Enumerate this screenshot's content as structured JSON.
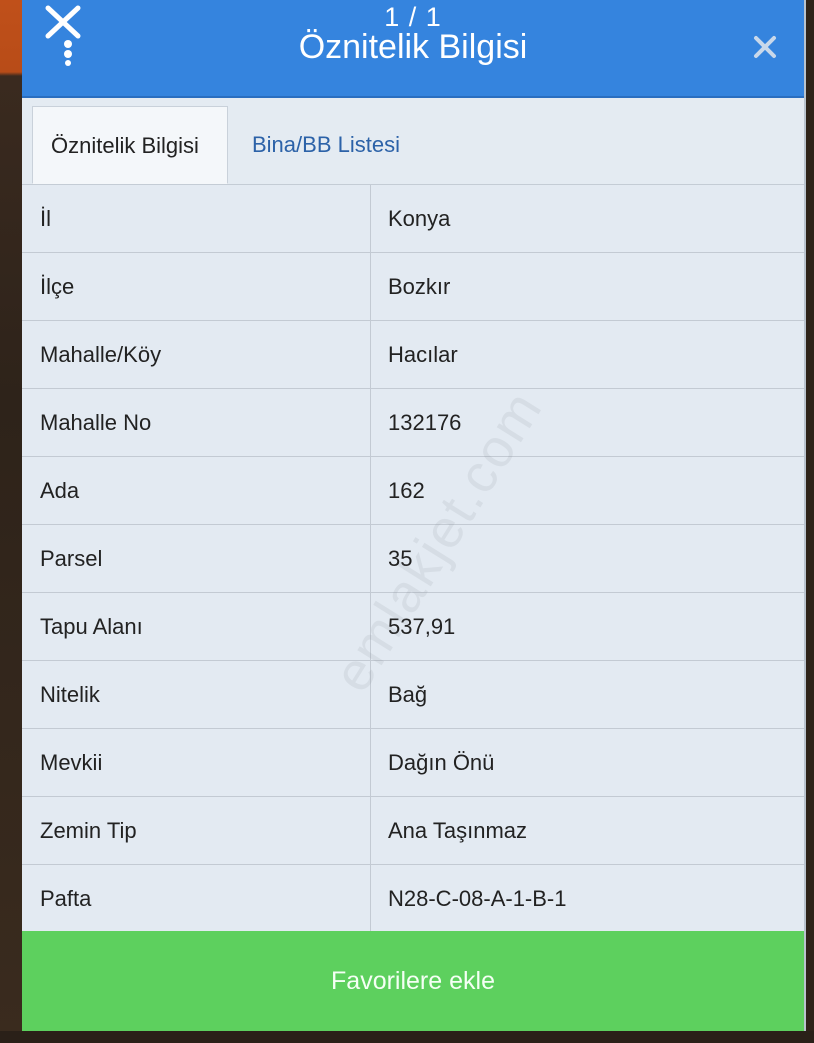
{
  "header": {
    "counter": "1 / 1",
    "title": "Öznitelik Bilgisi",
    "tool_icon": "scissors-tool-icon",
    "close_icon": "close-icon",
    "color": "#3584de"
  },
  "tabs": [
    {
      "label": "Öznitelik Bilgisi",
      "active": true
    },
    {
      "label": "Bina/BB Listesi",
      "active": false
    }
  ],
  "attributes": [
    {
      "key": "İl",
      "value": "Konya"
    },
    {
      "key": "İlçe",
      "value": "Bozkır"
    },
    {
      "key": "Mahalle/Köy",
      "value": "Hacılar"
    },
    {
      "key": "Mahalle No",
      "value": "132176"
    },
    {
      "key": "Ada",
      "value": "162"
    },
    {
      "key": "Parsel",
      "value": "35"
    },
    {
      "key": "Tapu Alanı",
      "value": "537,91"
    },
    {
      "key": "Nitelik",
      "value": "Bağ"
    },
    {
      "key": "Mevkii",
      "value": "Dağın Önü"
    },
    {
      "key": "Zemin Tip",
      "value": "Ana Taşınmaz"
    },
    {
      "key": "Pafta",
      "value": "N28-C-08-A-1-B-1"
    }
  ],
  "footer": {
    "favorite_label": "Favorilere ekle",
    "color": "#5dd05e"
  },
  "watermark": "emlakjet.com"
}
